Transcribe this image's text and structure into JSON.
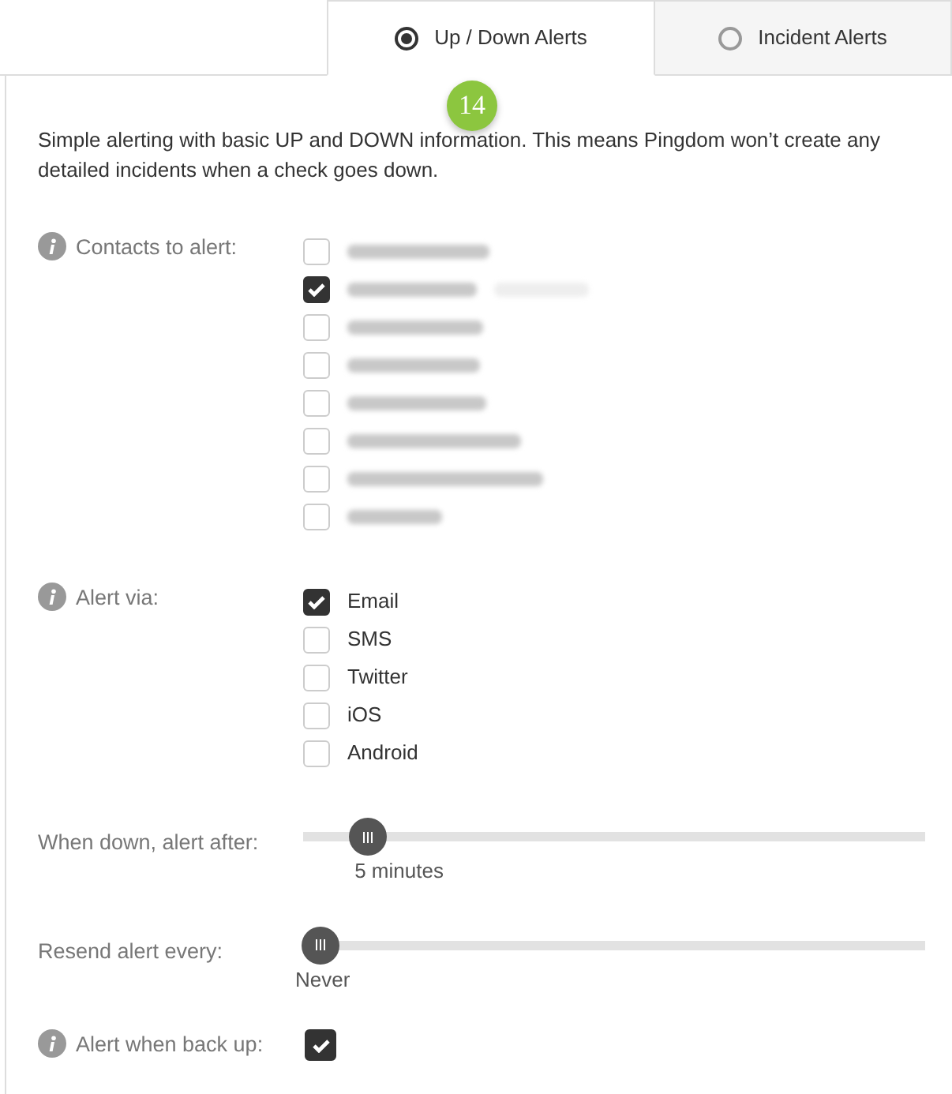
{
  "tabs": [
    {
      "label": "Up / Down Alerts",
      "selected": true
    },
    {
      "label": "Incident Alerts",
      "selected": false
    }
  ],
  "step_badge": "14",
  "description": "Simple alerting with basic UP and DOWN information. This means Pingdom won’t create any detailed incidents when a check goes down.",
  "contacts": {
    "label": "Contacts to alert:",
    "items": [
      {
        "checked": false,
        "redacted": true
      },
      {
        "checked": true,
        "redacted": true
      },
      {
        "checked": false,
        "redacted": true
      },
      {
        "checked": false,
        "redacted": true
      },
      {
        "checked": false,
        "redacted": true
      },
      {
        "checked": false,
        "redacted": true
      },
      {
        "checked": false,
        "redacted": true
      },
      {
        "checked": false,
        "redacted": true
      }
    ]
  },
  "alert_via": {
    "label": "Alert via:",
    "items": [
      {
        "name": "Email",
        "checked": true
      },
      {
        "name": "SMS",
        "checked": false
      },
      {
        "name": "Twitter",
        "checked": false
      },
      {
        "name": "iOS",
        "checked": false
      },
      {
        "name": "Android",
        "checked": false
      }
    ]
  },
  "sliders": [
    {
      "label": "When down, alert after:",
      "level": 0.08,
      "reading": "5 minutes"
    },
    {
      "label": "Resend alert every:",
      "level": 0,
      "reading": "Never"
    }
  ],
  "back_up": {
    "label": "Alert when back up:",
    "checked": true
  }
}
